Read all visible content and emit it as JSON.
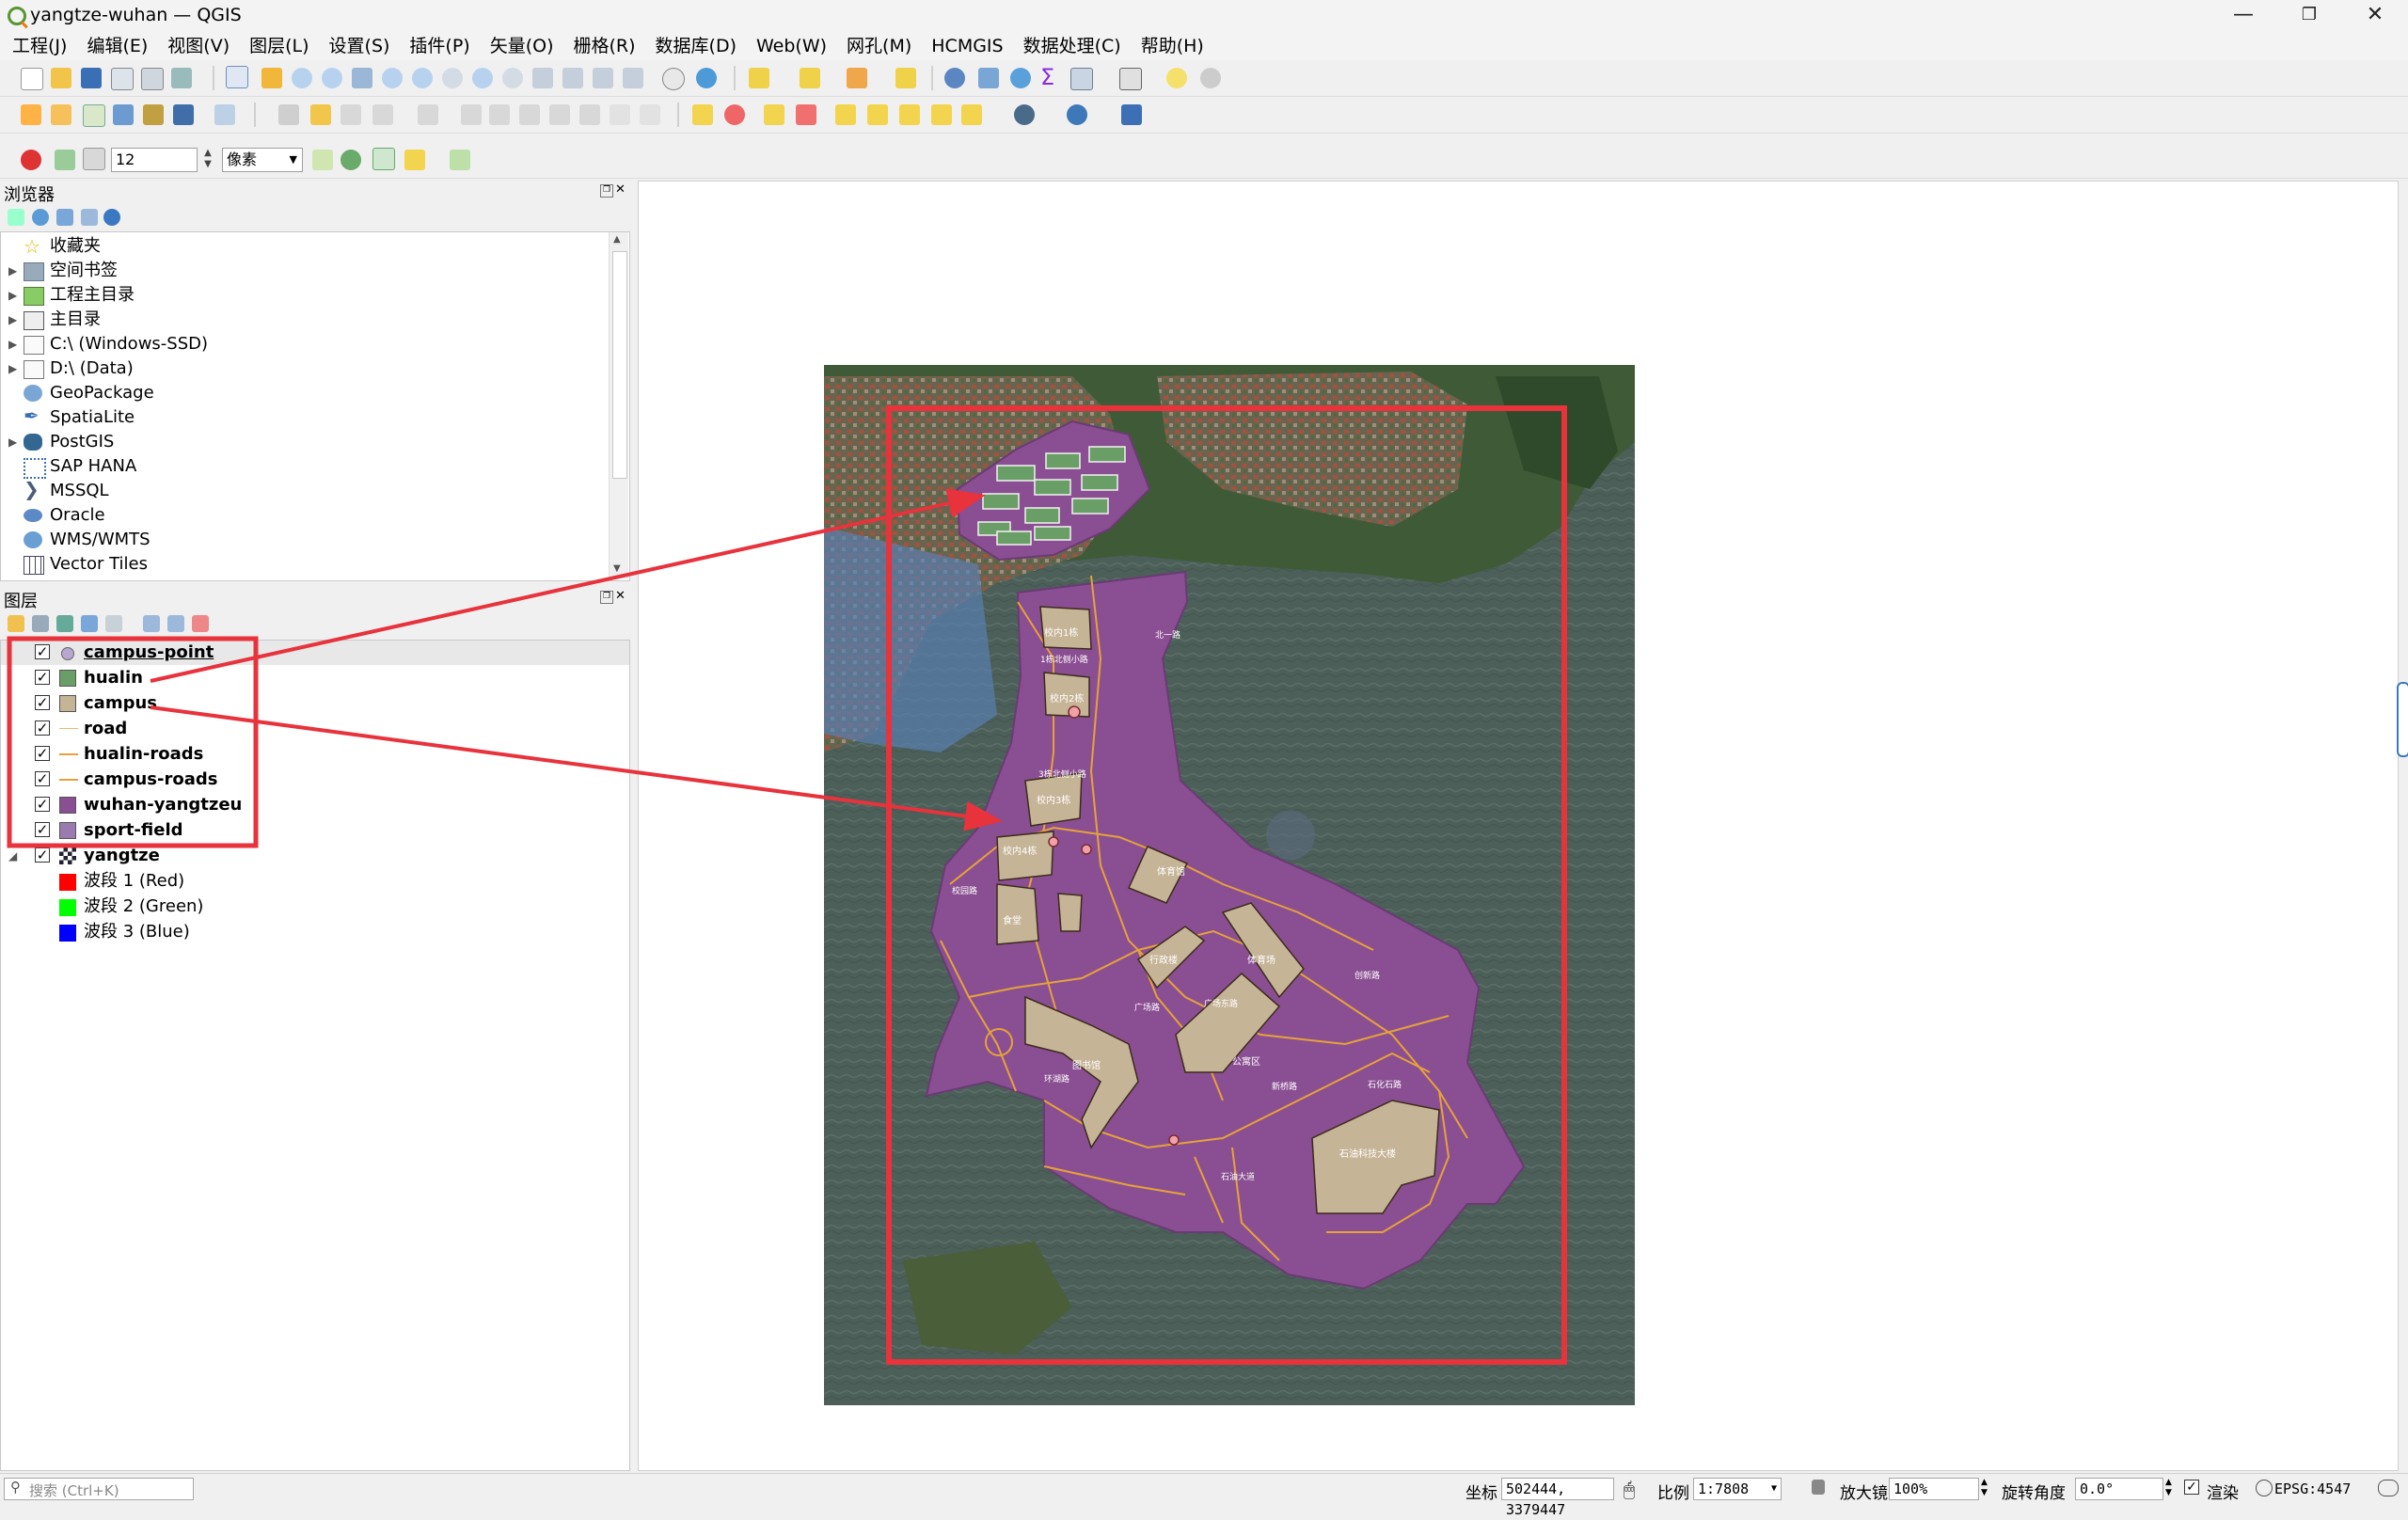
{
  "window": {
    "title": "yangtze-wuhan — QGIS"
  },
  "menubar": [
    "工程(J)",
    "编辑(E)",
    "视图(V)",
    "图层(L)",
    "设置(S)",
    "插件(P)",
    "矢量(O)",
    "栅格(R)",
    "数据库(D)",
    "Web(W)",
    "网孔(M)",
    "HCMGIS",
    "数据处理(C)",
    "帮助(H)"
  ],
  "snapping": {
    "tolerance": "12",
    "unit": "像素"
  },
  "browser": {
    "title": "浏览器",
    "items": [
      "收藏夹",
      "空间书签",
      "工程主目录",
      "主目录",
      "C:\\ (Windows-SSD)",
      "D:\\ (Data)",
      "GeoPackage",
      "SpatiaLite",
      "PostGIS",
      "SAP HANA",
      "MSSQL",
      "Oracle",
      "WMS/WMTS",
      "Vector Tiles"
    ]
  },
  "layers": {
    "title": "图层",
    "items": [
      "campus-point",
      "hualin",
      "campus",
      "road",
      "hualin-roads",
      "campus-roads",
      "wuhan-yangtzeu",
      "sport-field"
    ],
    "group": "yangtze",
    "bands": [
      "波段 1 (Red)",
      "波段 2 (Green)",
      "波段 3 (Blue)"
    ],
    "colors": {
      "hualin": "#6a9e67",
      "campus": "#c6b497",
      "road": "#e6b872",
      "wuhan-yangtzeu": "#8a4f92",
      "sport-field": "#9a7bb0",
      "campus-point": "#b9a6d0",
      "band1": "#ff0000",
      "band2": "#00ff00",
      "band3": "#0000ff"
    }
  },
  "map": {
    "campus_labels": [
      "校内1栋",
      "校内2栋",
      "校内3栋",
      "校内4栋",
      "体育馆",
      "食堂",
      "图书馆",
      "行政楼",
      "石油科技大楼",
      "体育场",
      "公寓区"
    ],
    "road_labels": [
      "校园路",
      "1栋北侧小路",
      "3栋北侧小路",
      "北一路",
      "环湖路",
      "广场东路",
      "创新路",
      "石化石路",
      "新桥路",
      "广场路",
      "石油大道"
    ]
  },
  "status": {
    "search_placeholder": "搜索 (Ctrl+K)",
    "coord_label": "坐标",
    "coord": "502444, 3379447",
    "scale_label": "比例",
    "scale": "1:7808",
    "magnifier_label": "放大镜",
    "magnifier": "100%",
    "rotation_label": "旋转角度",
    "rotation": "0.0°",
    "render_label": "渲染",
    "crs": "EPSG:4547"
  },
  "accent": "#e8323c"
}
